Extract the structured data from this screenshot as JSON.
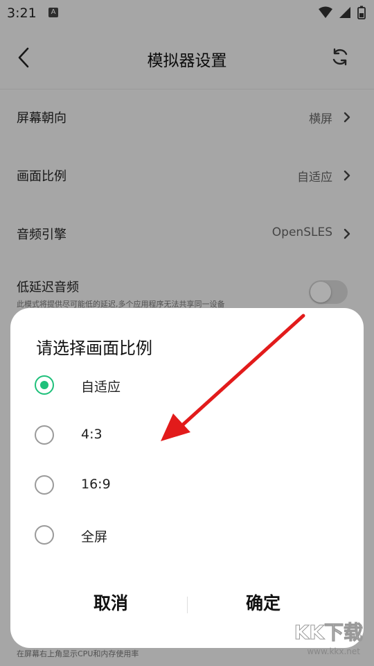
{
  "status": {
    "time": "3:21",
    "a_badge": "A"
  },
  "header": {
    "title": "模拟器设置"
  },
  "settings": [
    {
      "label": "屏幕朝向",
      "value": "横屏"
    },
    {
      "label": "画面比例",
      "value": "自适应"
    },
    {
      "label": "音频引擎",
      "value": "OpenSLES"
    }
  ],
  "low_latency": {
    "label": "低延迟音频",
    "desc": "此模式将提供尽可能低的延迟,多个应用程序无法共享同一设备",
    "on": false
  },
  "bottom_hint": "在屏幕右上角显示CPU和内存使用率",
  "dialog": {
    "title": "请选择画面比例",
    "options": [
      {
        "label": "自适应",
        "selected": true
      },
      {
        "label": "4:3",
        "selected": false
      },
      {
        "label": "16:9",
        "selected": false
      },
      {
        "label": "全屏",
        "selected": false
      }
    ],
    "cancel": "取消",
    "confirm": "确定"
  },
  "watermark": {
    "brand": "KK下载",
    "url": "www.kkx.net"
  },
  "colors": {
    "accent": "#1ec07a",
    "arrow": "#e21b1b"
  }
}
